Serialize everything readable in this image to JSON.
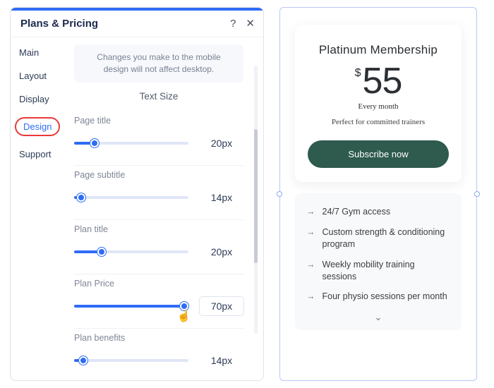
{
  "panel": {
    "title": "Plans & Pricing",
    "help_icon": "?",
    "close_icon": "✕",
    "tabs": [
      "Main",
      "Layout",
      "Display",
      "Design",
      "Support"
    ],
    "active_tab_index": 3,
    "notice": "Changes you make to the mobile design will not affect desktop.",
    "section_heading": "Text Size",
    "sliders": [
      {
        "label": "Page title",
        "value": 20,
        "unit": "px",
        "pct": 18
      },
      {
        "label": "Page subtitle",
        "value": 14,
        "unit": "px",
        "pct": 6
      },
      {
        "label": "Plan title",
        "value": 20,
        "unit": "px",
        "pct": 24
      },
      {
        "label": "Plan Price",
        "value": 70,
        "unit": "px",
        "pct": 96,
        "hot": true
      },
      {
        "label": "Plan benefits",
        "value": 14,
        "unit": "px",
        "pct": 8
      }
    ]
  },
  "preview": {
    "plan_title": "Platinum Membership",
    "currency": "$",
    "price": "55",
    "period": "Every month",
    "subtitle": "Perfect for committed trainers",
    "cta": "Subscribe now",
    "benefits": [
      "24/7 Gym access",
      "Custom strength & conditioning program",
      "Weekly mobility training sessions",
      "Four physio sessions per month"
    ],
    "arrow_glyph": "→",
    "expand_glyph": "⌄"
  },
  "colors": {
    "accent": "#2f6cf6",
    "highlight_ring": "#e83a3a",
    "cta_bg": "#2f5a4e"
  }
}
